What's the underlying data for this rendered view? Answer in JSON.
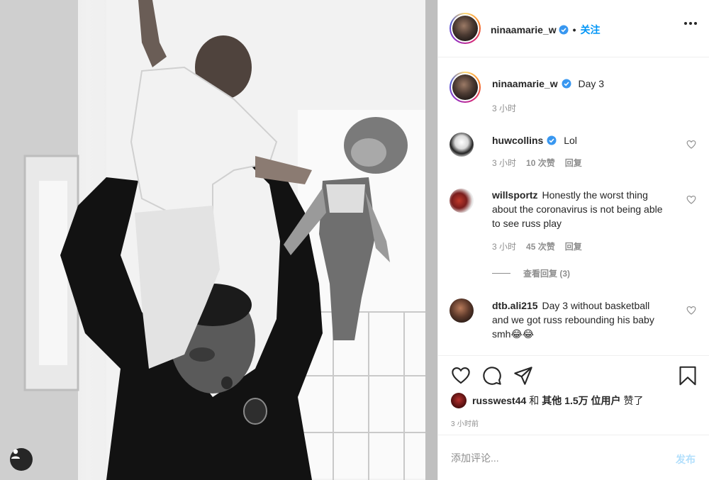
{
  "post": {
    "author": "ninaamarie_w",
    "follow_label": "关注",
    "caption": "Day 3",
    "caption_time": "3 小时"
  },
  "comments": [
    {
      "user": "huwcollins",
      "verified": true,
      "text": "Lol",
      "time": "3 小时",
      "likes": "10 次赞",
      "reply": "回复"
    },
    {
      "user": "willsportz",
      "verified": false,
      "text": "Honestly the worst thing about the coronavirus is not being able to see russ play",
      "time": "3 小时",
      "likes": "45 次赞",
      "reply": "回复",
      "view_replies": "查看回复 (3)"
    },
    {
      "user": "dtb.ali215",
      "verified": false,
      "text": "Day 3 without basketball and we got russ rebounding his baby smh😂😂"
    }
  ],
  "likes": {
    "user": "russwest44",
    "and": "和",
    "others": "其他 1.5万 位用户",
    "liked": "赞了"
  },
  "time_ago": "3 小时前",
  "comment_box": {
    "placeholder": "添加评论...",
    "post_label": "发布"
  },
  "colors": {
    "accent": "#0095f6",
    "disabled_post": "#b2dffc",
    "muted": "#8e8e8e"
  },
  "icons": [
    "verified-icon",
    "more-icon",
    "heart-icon",
    "comment-icon",
    "share-icon",
    "bookmark-icon",
    "user-tag-icon"
  ]
}
